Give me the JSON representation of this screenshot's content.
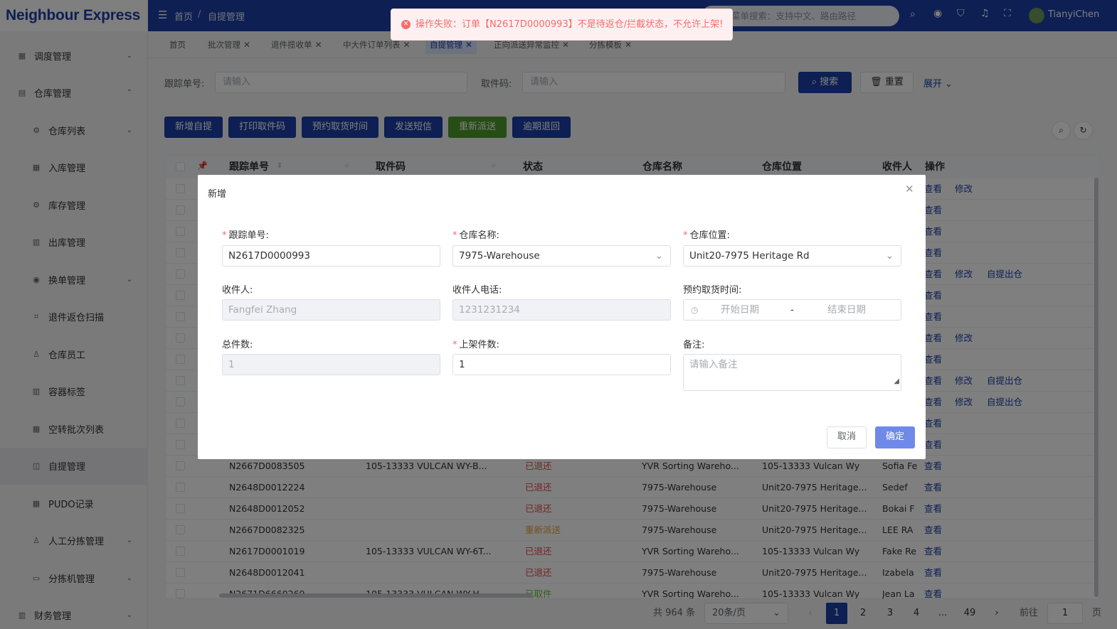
{
  "app": {
    "logo": "Neighbour Express"
  },
  "topbar": {
    "breadcrumb": [
      "首页",
      "/",
      "自提管理"
    ],
    "search_placeholder": "菜单搜索：支持中文、路由路径",
    "user": "TianyiChen"
  },
  "toast": {
    "message": "操作失败：订单【N2617D0000993】不是待返仓/拦截状态，不允许上架!"
  },
  "sidebar": {
    "items": [
      {
        "label": "调度管理",
        "icon": "grid-icon",
        "level": 1,
        "arrow": "⌄"
      },
      {
        "label": "仓库管理",
        "icon": "warehouse-icon",
        "level": 1,
        "arrow": "⌃"
      },
      {
        "label": "仓库列表",
        "icon": "gear-icon",
        "level": 2,
        "arrow": "⌄"
      },
      {
        "label": "入库管理",
        "icon": "grid-icon",
        "level": 2,
        "arrow": ""
      },
      {
        "label": "库存管理",
        "icon": "gear-icon",
        "level": 2,
        "arrow": ""
      },
      {
        "label": "出库管理",
        "icon": "doc-icon",
        "level": 2,
        "arrow": ""
      },
      {
        "label": "换单管理",
        "icon": "eye-icon",
        "level": 2,
        "arrow": "⌄"
      },
      {
        "label": "退件返仓扫描",
        "icon": "scan-icon",
        "level": 2,
        "arrow": ""
      },
      {
        "label": "仓库员工",
        "icon": "user-icon",
        "level": 2,
        "arrow": ""
      },
      {
        "label": "容器标签",
        "icon": "doc-icon",
        "level": 2,
        "arrow": ""
      },
      {
        "label": "空转批次列表",
        "icon": "grid-icon",
        "level": 2,
        "arrow": ""
      },
      {
        "label": "自提管理",
        "icon": "bag-icon",
        "level": 2,
        "arrow": ""
      },
      {
        "label": "PUDO记录",
        "icon": "grid-icon",
        "level": 2,
        "arrow": ""
      },
      {
        "label": "人工分拣管理",
        "icon": "user-icon",
        "level": 2,
        "arrow": "⌄"
      },
      {
        "label": "分拣机管理",
        "icon": "machine-icon",
        "level": 2,
        "arrow": "⌄"
      },
      {
        "label": "财务管理",
        "icon": "doc-icon",
        "level": 1,
        "arrow": "⌄"
      }
    ]
  },
  "tabs": [
    {
      "label": "首页",
      "closable": false
    },
    {
      "label": "批次管理",
      "closable": true
    },
    {
      "label": "退件揽收单",
      "closable": true
    },
    {
      "label": "中大件订单列表",
      "closable": true
    },
    {
      "label": "自提管理",
      "closable": true,
      "active": true
    },
    {
      "label": "正向派送异常监控",
      "closable": true
    },
    {
      "label": "分拣模板",
      "closable": true
    }
  ],
  "filters": {
    "tracking_label": "跟踪单号:",
    "tracking_placeholder": "请输入",
    "pickup_label": "取件码:",
    "pickup_placeholder": "请输入",
    "search": "搜索",
    "reset": "重置",
    "expand": "展开"
  },
  "actions": [
    "新增自提",
    "打印取件码",
    "预约取货时间",
    "发送短信",
    "重新派送",
    "逾期退回"
  ],
  "table": {
    "headers": [
      "跟踪单号",
      "取件码",
      "状态",
      "仓库名称",
      "仓库位置",
      "收件人",
      "操作"
    ],
    "top_ops": [
      [
        "查看",
        "修改",
        ""
      ],
      [
        "查看",
        "",
        ""
      ],
      [
        "查看",
        "",
        ""
      ],
      [
        "查看",
        "",
        ""
      ],
      [
        "查看",
        "修改",
        "自提出仓"
      ],
      [
        "查看",
        "",
        ""
      ],
      [
        "查看",
        "",
        ""
      ],
      [
        "查看",
        "修改",
        ""
      ],
      [
        "查看",
        "",
        ""
      ],
      [
        "查看",
        "修改",
        "自提出仓"
      ],
      [
        "查看",
        "修改",
        "自提出仓"
      ],
      [
        "查看",
        "",
        ""
      ],
      [
        "查看",
        "",
        ""
      ]
    ],
    "rows": [
      {
        "tracking": "N2667D0083505",
        "code": "105-13333 VULCAN WY-B...",
        "status": "已退还",
        "status_color": "red",
        "wh": "YVR Sorting Wareho...",
        "loc": "105-13333 Vulcan Wy",
        "recv": "Sofia Fe",
        "op": "查看"
      },
      {
        "tracking": "N2648D0012224",
        "code": "",
        "status": "已退还",
        "status_color": "red",
        "wh": "7975-Warehouse",
        "loc": "Unit20-7975 Heritage...",
        "recv": "Sedef",
        "op": "查看"
      },
      {
        "tracking": "N2648D0012052",
        "code": "",
        "status": "已退还",
        "status_color": "red",
        "wh": "7975-Warehouse",
        "loc": "Unit20-7975 Heritage...",
        "recv": "Bokai F",
        "op": "查看"
      },
      {
        "tracking": "N2667D0082325",
        "code": "",
        "status": "重新派送",
        "status_color": "orange",
        "wh": "7975-Warehouse",
        "loc": "Unit20-7975 Heritage...",
        "recv": "LEE RA",
        "op": "查看"
      },
      {
        "tracking": "N2617D0001019",
        "code": "105-13333 VULCAN WY-6T...",
        "status": "已退还",
        "status_color": "red",
        "wh": "YVR Sorting Wareho...",
        "loc": "105-13333 Vulcan Wy",
        "recv": "Fake Re",
        "op": "查看"
      },
      {
        "tracking": "N2648D0012041",
        "code": "",
        "status": "已退还",
        "status_color": "red",
        "wh": "7975-Warehouse",
        "loc": "Unit20-7975 Heritage...",
        "recv": "Izabela",
        "op": "查看"
      },
      {
        "tracking": "N2671D6660269",
        "code": "105-13333 VULCAN WY-H...",
        "status": "已取件",
        "status_color": "green",
        "wh": "YVR Sorting Wareho...",
        "loc": "105-13333 Vulcan Wy",
        "recv": "Jean La",
        "op": "查看"
      }
    ]
  },
  "pagination": {
    "total": "共 964 条",
    "page_size": "20条/页",
    "pages": [
      "1",
      "2",
      "3",
      "4",
      "...",
      "49"
    ],
    "goto_label": "前往",
    "goto_value": "1",
    "page_suffix": "页"
  },
  "dialog": {
    "title": "新增",
    "fields": {
      "tracking": {
        "label": "跟踪单号:",
        "value": "N2617D0000993"
      },
      "warehouse": {
        "label": "仓库名称:",
        "value": "7975-Warehouse"
      },
      "location": {
        "label": "仓库位置:",
        "value": "Unit20-7975 Heritage Rd"
      },
      "recipient": {
        "label": "收件人:",
        "value": "Fangfei Zhang"
      },
      "phone": {
        "label": "收件人电话:",
        "value": "1231231234"
      },
      "appointment": {
        "label": "预约取货时间:",
        "start": "开始日期",
        "sep": "-",
        "end": "结束日期"
      },
      "total": {
        "label": "总件数:",
        "value": "1"
      },
      "shelved": {
        "label": "上架件数:",
        "value": "1"
      },
      "remark": {
        "label": "备注:",
        "placeholder": "请输入备注"
      }
    },
    "cancel": "取消",
    "confirm": "确定"
  }
}
